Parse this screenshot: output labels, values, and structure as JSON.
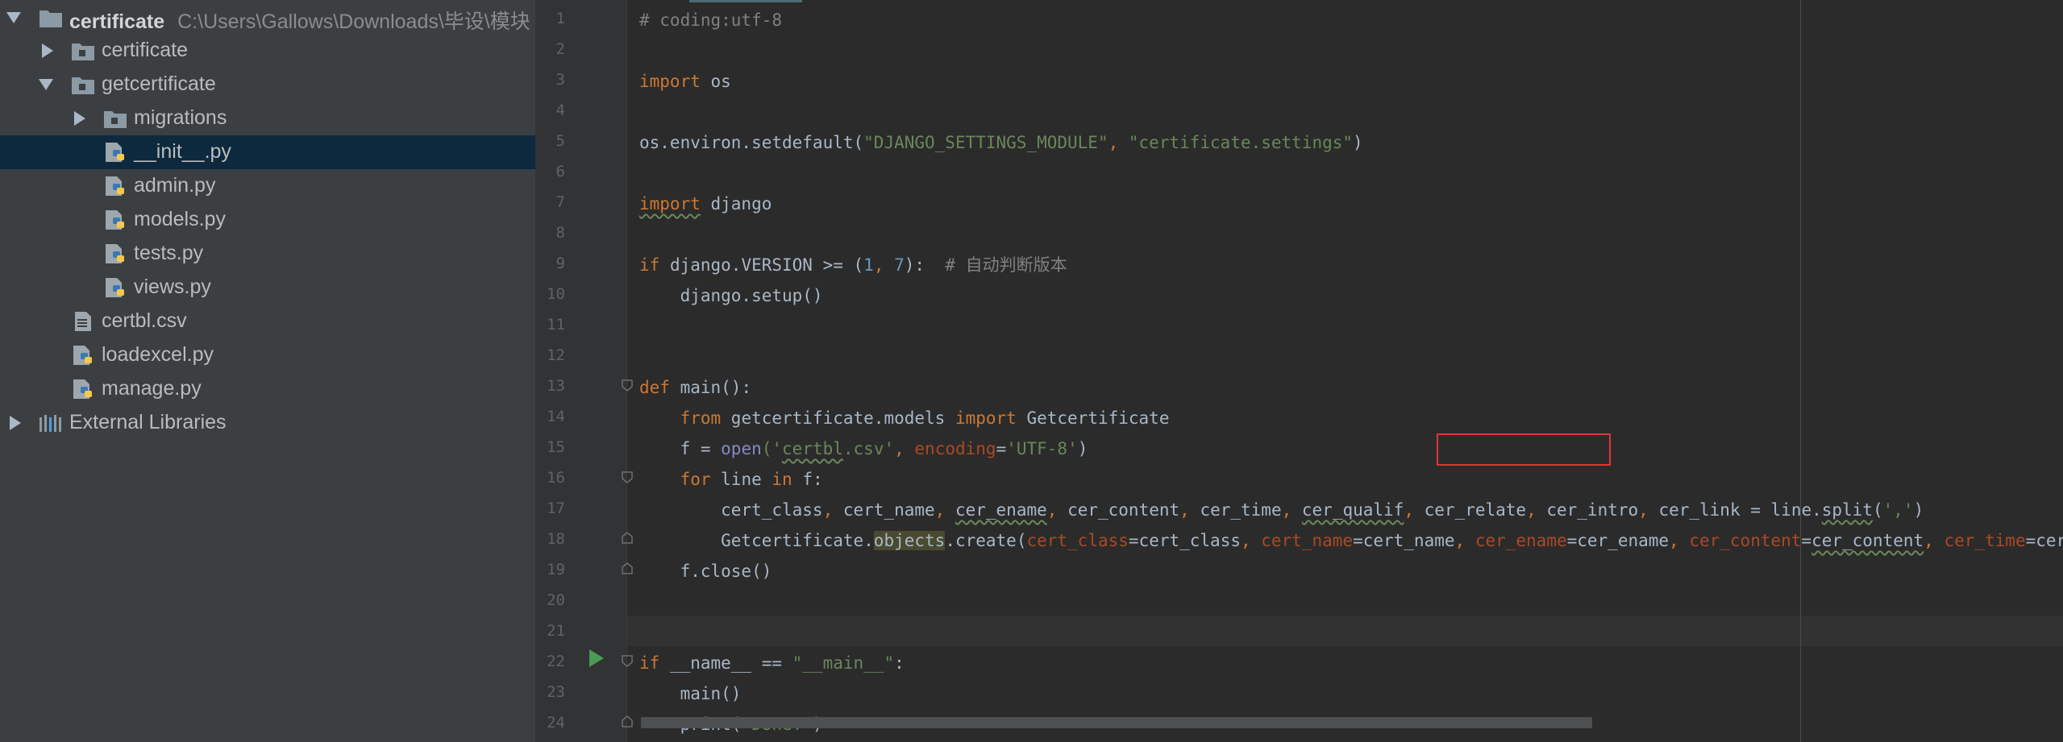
{
  "project_tree": {
    "root": {
      "name": "certificate",
      "path": "C:\\Users\\Gallows\\Downloads\\毕设\\模块"
    },
    "items": [
      {
        "label": "certificate",
        "type": "folder"
      },
      {
        "label": "getcertificate",
        "type": "folder"
      },
      {
        "label": "migrations",
        "type": "folder"
      },
      {
        "label": "__init__.py",
        "type": "python",
        "selected": true
      },
      {
        "label": "admin.py",
        "type": "python"
      },
      {
        "label": "models.py",
        "type": "python"
      },
      {
        "label": "tests.py",
        "type": "python"
      },
      {
        "label": "views.py",
        "type": "python"
      },
      {
        "label": "certbl.csv",
        "type": "text"
      },
      {
        "label": "loadexcel.py",
        "type": "python"
      },
      {
        "label": "manage.py",
        "type": "python"
      },
      {
        "label": "External Libraries",
        "type": "libraries"
      }
    ]
  },
  "editor": {
    "line_numbers": [
      "1",
      "2",
      "3",
      "4",
      "5",
      "6",
      "7",
      "8",
      "9",
      "10",
      "11",
      "12",
      "13",
      "14",
      "15",
      "16",
      "17",
      "18",
      "19",
      "20",
      "21",
      "22",
      "23",
      "24"
    ],
    "code": {
      "l1": [
        "# coding:utf-8"
      ],
      "l3": [
        "import",
        " os"
      ],
      "l5": [
        "os.environ.setdefault(",
        "\"DJANGO_SETTINGS_MODULE\"",
        ", ",
        "\"certificate.settings\"",
        ")"
      ],
      "l7": [
        "import",
        " django"
      ],
      "l9": [
        "if",
        " django.VERSION >= (",
        "1",
        ", ",
        "7",
        "):  ",
        "# 自动判断版本"
      ],
      "l10": [
        "    django.setup()"
      ],
      "l13": [
        "def",
        " main():"
      ],
      "l14": [
        "    ",
        "from",
        " getcertificate.models ",
        "import",
        " Getcertificate"
      ],
      "l15": [
        "    f = ",
        "open",
        "('",
        "certbl",
        ".csv'",
        ", ",
        "encoding",
        "=",
        "'UTF-8'",
        ")"
      ],
      "l16": [
        "    ",
        "for",
        " line ",
        "in",
        " f:"
      ],
      "l17": [
        "        cert_class",
        ", ",
        "cert_name",
        ", ",
        "cer_ename",
        ", ",
        "cer_content",
        ", ",
        "cer_time",
        ", ",
        "cer_qualif",
        ", ",
        "cer_relate",
        ", ",
        "cer_intro",
        ", ",
        "cer_link = line.",
        "split",
        "(",
        "','",
        ")"
      ],
      "l18": [
        "        Getcertificate.",
        "objects",
        ".create(",
        "cert_class",
        "=cert_class",
        ", ",
        "cert_name",
        "=cert_name",
        ", ",
        "cer_ename",
        "=cer_ename",
        ", ",
        "cer_content",
        "=",
        "cer_content",
        ", ",
        "cer_time",
        "=cer_time",
        ", "
      ],
      "l19": [
        "    f.close()"
      ],
      "l22": [
        "if",
        " __name__ == ",
        "\"__main__\"",
        ":"
      ],
      "l23": [
        "    main()"
      ],
      "l24": [
        "    print(",
        "'Done!'",
        ")"
      ]
    }
  },
  "colors": {
    "keyword": "#cc7832",
    "string": "#6a8759",
    "number": "#6897bb",
    "comment": "#808080",
    "kwarg": "#aa4926",
    "highlight_box": "#e03535",
    "run_icon": "#499c54"
  },
  "icons": {
    "folder": "folder-icon",
    "python": "python-file-icon",
    "text": "text-file-icon",
    "libraries": "libraries-icon",
    "run": "run-icon",
    "expand": "chevron-down-icon",
    "collapse": "chevron-right-icon"
  }
}
